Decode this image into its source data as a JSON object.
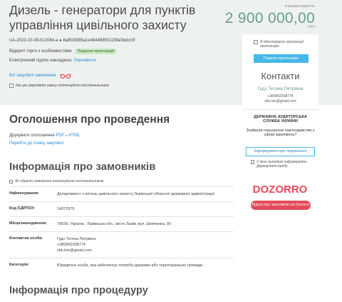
{
  "header": {
    "title": "Дизель - генератори для пунктів управління цивільного захисту",
    "id_line": "UA-2023-10-09-012084-a ● 8a8f28385a1e48449850129fa0bdcc0f",
    "status_prefix": "Відкриті торги з особливостями",
    "status_badge": "Подання пропозицій",
    "sign_prefix": "Електронний підпис накладено.",
    "sign_link": "Перевірити",
    "all_purchases": "Всі закупівлі замовника",
    "attention": "На цю закупівлю увагу потенційно постачальника",
    "est_label": "очікувана вартість",
    "price": "2 900 000,00",
    "currency": "UAH"
  },
  "card": {
    "check_text": "Я підготувати пропозиції",
    "check_text2": "пропозицію",
    "submit_button": "Подати пропозицію",
    "contacts_title": "Контакти",
    "contact_name": "Гудз Тетяна Петрівна",
    "contact_phone": "+380962938774",
    "contact_email": "vkb.lviv@gmail.com"
  },
  "notice": {
    "title": "Оголошення про проведення",
    "print_prefix": "Друкувати оголошення",
    "print_pdf": "PDF",
    "print_sep": "●",
    "print_html": "HTML",
    "to_plan": "Перейти до плану закупівлі"
  },
  "customer": {
    "title": "Інформація про замовників",
    "attn": "Як обрати замовника потенційним постачальником",
    "rows": [
      {
        "k": "Найменування:",
        "v": "Департамент з питань цивільного захисту Львівської обласної державної адміністрації"
      },
      {
        "k": "Код ЄДРПОУ:",
        "v": "14372975"
      },
      {
        "k": "Місцезнаходження:",
        "v": "79039, Україна , Львівська обл., місто Львів, вул. Шевченка, 90"
      },
      {
        "k": "Контактна особа:",
        "v": "Гудз Тетяна Петрівна\n+380962938774\nvkb.lviv@gmail.com"
      },
      {
        "k": "Категорія:",
        "v": "Юридична особа, яка забезпечує потреби держави або територіальної громади"
      }
    ]
  },
  "procedure": {
    "title": "Інформація про процедуру"
  },
  "audit": {
    "title": "ДЕРЖАВНА АУДИТОРСЬКА СЛУЖБА УКРАЇНИ",
    "question": "Знайшли порушення законодавства у сфері закупівель?",
    "button": "Інформувати про порушення",
    "check": "У яких випадках інформувати Держаудитслужбу"
  },
  "dozorro": {
    "logo": "DOZORRO",
    "button": "Відгук про закупівлю на Dozorro"
  },
  "colors": {
    "accent_green": "#6a9f86",
    "link_blue": "#2b8bd5",
    "button_blue": "#45b7e8",
    "dozorro_red": "#e34b5a"
  }
}
